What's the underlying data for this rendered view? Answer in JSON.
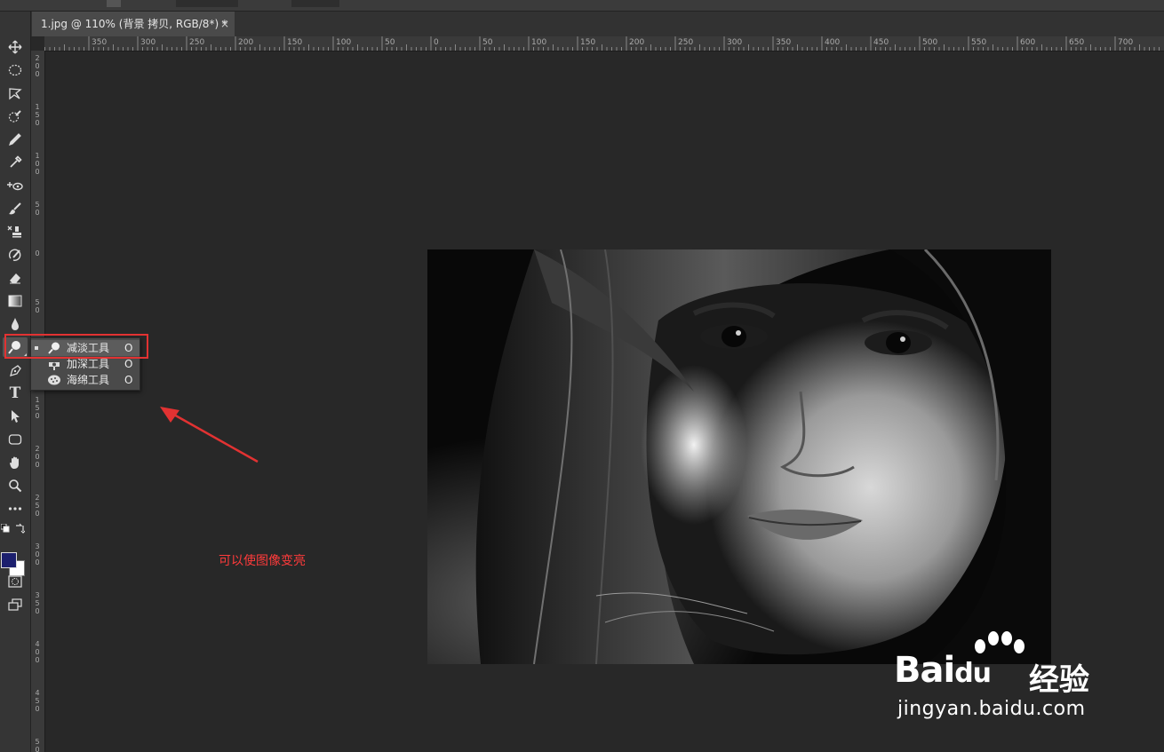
{
  "document_tab": {
    "title": "1.jpg @ 110% (背景 拷贝, RGB/8*) *",
    "close_glyph": "×"
  },
  "ruler": {
    "horizontal_labels": [
      "350",
      "300",
      "250",
      "200",
      "150",
      "100",
      "50",
      "0",
      "50",
      "100",
      "150",
      "200",
      "250",
      "300",
      "350",
      "400",
      "450",
      "500",
      "550",
      "600",
      "650",
      "700"
    ],
    "vertical_labels": [
      "200",
      "150",
      "100",
      "50",
      "0",
      "50",
      "100",
      "150",
      "200",
      "250",
      "300",
      "350",
      "400",
      "450",
      "500"
    ]
  },
  "toolbar": {
    "tools": [
      {
        "name": "move-tool-icon"
      },
      {
        "name": "elliptical-marquee-tool-icon"
      },
      {
        "name": "lasso-tool-icon"
      },
      {
        "name": "quick-selection-tool-icon"
      },
      {
        "name": "pen-brush-tool-icon"
      },
      {
        "name": "eyedropper-tool-icon"
      },
      {
        "name": "spot-healing-tool-icon"
      },
      {
        "name": "brush-tool-icon"
      },
      {
        "name": "clone-stamp-tool-icon"
      },
      {
        "name": "history-brush-tool-icon"
      },
      {
        "name": "eraser-tool-icon"
      },
      {
        "name": "gradient-tool-icon"
      },
      {
        "name": "blur-tool-icon"
      },
      {
        "name": "dodge-tool-icon"
      },
      {
        "name": "pen-tool-icon"
      },
      {
        "name": "type-tool-icon"
      },
      {
        "name": "path-selection-tool-icon"
      },
      {
        "name": "rectangle-tool-icon"
      },
      {
        "name": "hand-tool-icon"
      },
      {
        "name": "zoom-tool-icon"
      },
      {
        "name": "more-tools-icon"
      }
    ],
    "type_tool_glyph": "T",
    "foreground_color": "#1c1f6e",
    "background_color": "#ffffff"
  },
  "flyout": {
    "items": [
      {
        "label": "减淡工具",
        "shortcut": "O",
        "selected": true,
        "icon": "dodge-icon"
      },
      {
        "label": "加深工具",
        "shortcut": "O",
        "selected": false,
        "icon": "burn-icon"
      },
      {
        "label": "海绵工具",
        "shortcut": "O",
        "selected": false,
        "icon": "sponge-icon"
      }
    ]
  },
  "annotation": {
    "text": "可以使图像变亮",
    "color": "#ff3b3b"
  },
  "watermark": {
    "brand": "Bai",
    "brand_suffix": "du",
    "product": "经验",
    "url": "jingyan.baidu.com"
  }
}
